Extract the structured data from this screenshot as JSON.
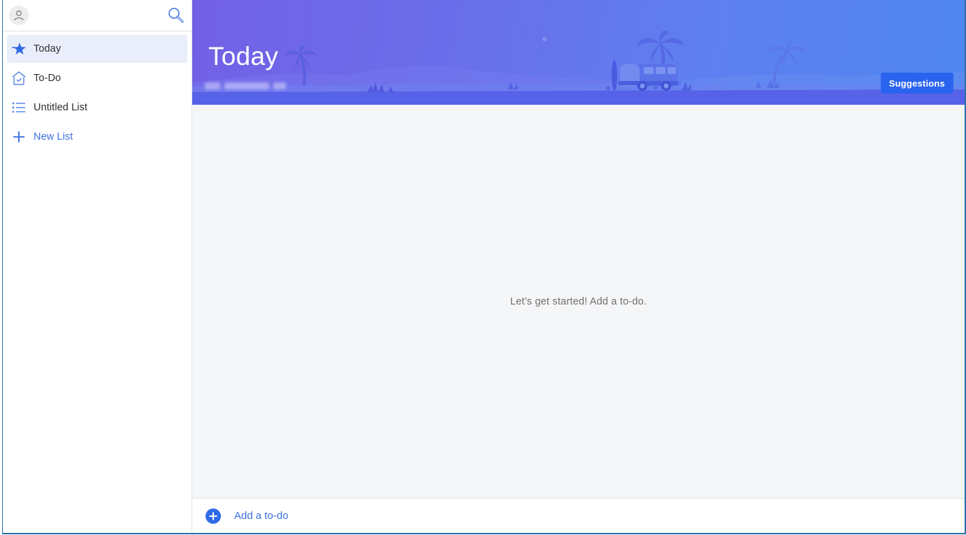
{
  "sidebar": {
    "avatar_icon": "user-icon",
    "search_icon": "search-icon",
    "items": [
      {
        "label": "Today",
        "icon": "star-icon",
        "active": true
      },
      {
        "label": "To-Do",
        "icon": "home-check-icon",
        "active": false
      },
      {
        "label": "Untitled List",
        "icon": "list-icon",
        "active": false
      },
      {
        "label": "New List",
        "icon": "plus-icon",
        "active": false
      }
    ]
  },
  "main": {
    "header": {
      "title": "Today",
      "date_redacted": true,
      "suggestions_label": "Suggestions"
    },
    "empty_message": "Let’s get started! Add a to-do.",
    "add_todo": {
      "label": "Add a to-do",
      "icon": "add-circle-icon"
    }
  },
  "colors": {
    "accent": "#3b6fe0",
    "button": "#2a63f0",
    "active_item_bg": "#eaeefa",
    "header_gradient_start": "#7260e6",
    "header_gradient_end": "#4f86f0",
    "window_border": "#2b6ca8"
  }
}
